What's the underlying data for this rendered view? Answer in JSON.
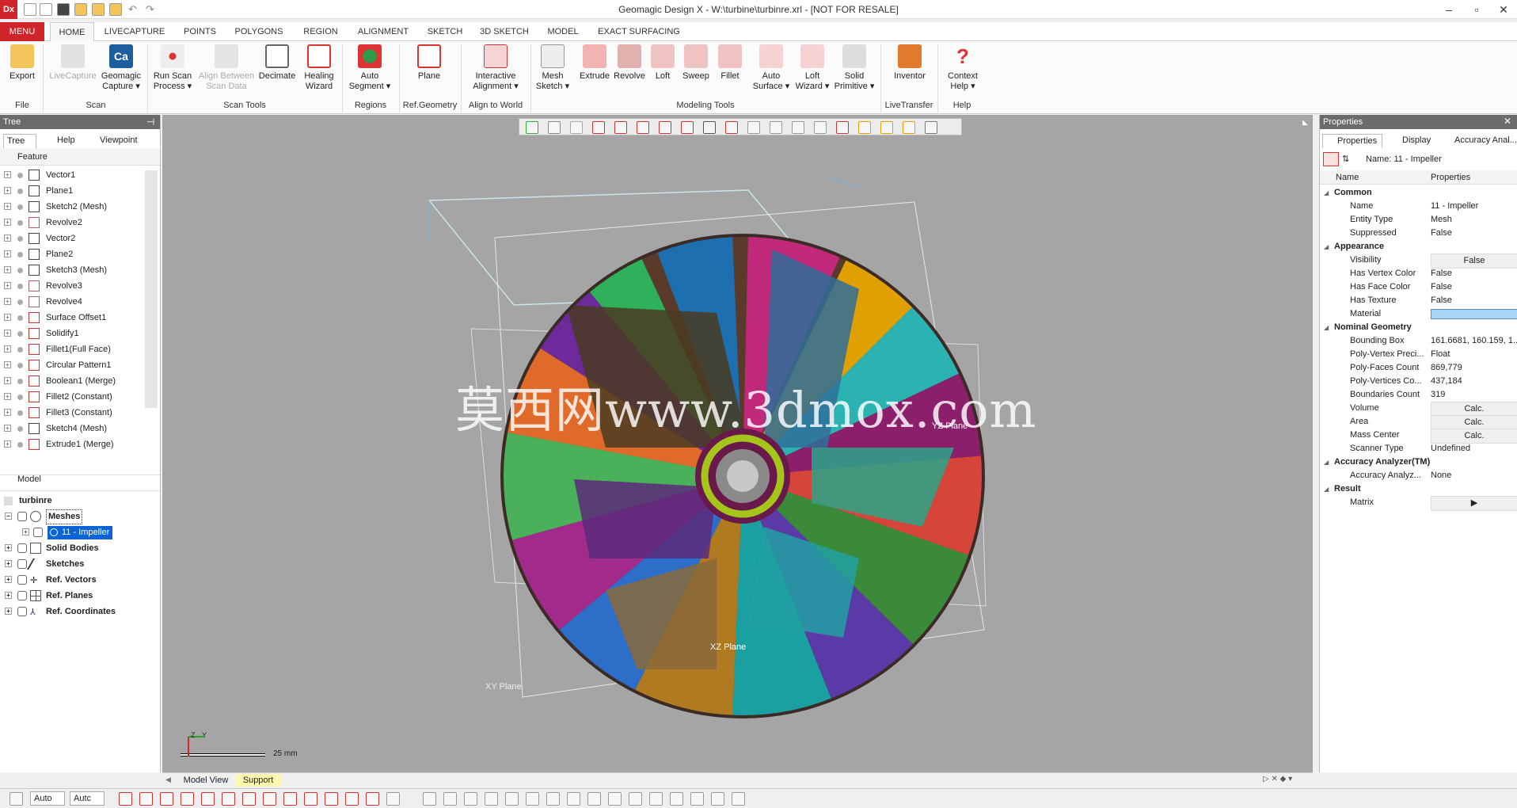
{
  "title": "Geomagic Design X - W:\\turbine\\turbinre.xrl - [NOT FOR RESALE]",
  "app_logo": "Dx",
  "window_controls": [
    "–",
    "▫",
    "✕"
  ],
  "menu_tabs": [
    "MENU",
    "HOME",
    "LIVECAPTURE",
    "POINTS",
    "POLYGONS",
    "REGION",
    "ALIGNMENT",
    "SKETCH",
    "3D SKETCH",
    "MODEL",
    "EXACT SURFACING"
  ],
  "ribbon": {
    "buttons": [
      {
        "label": "Export",
        "sub": ""
      },
      {
        "label": "LiveCapture",
        "sub": ""
      },
      {
        "label": "Geomagic",
        "sub": "Capture ▾"
      },
      {
        "label": "Run Scan",
        "sub": "Process ▾"
      },
      {
        "label": "Align Between",
        "sub": "Scan Data"
      },
      {
        "label": "Decimate",
        "sub": ""
      },
      {
        "label": "Healing",
        "sub": "Wizard"
      },
      {
        "label": "Auto",
        "sub": "Segment ▾"
      },
      {
        "label": "Plane",
        "sub": ""
      },
      {
        "label": "Interactive",
        "sub": "Alignment ▾"
      },
      {
        "label": "Mesh",
        "sub": "Sketch ▾"
      },
      {
        "label": "Extrude",
        "sub": ""
      },
      {
        "label": "Revolve",
        "sub": ""
      },
      {
        "label": "Loft",
        "sub": ""
      },
      {
        "label": "Sweep",
        "sub": ""
      },
      {
        "label": "Fillet",
        "sub": ""
      },
      {
        "label": "Auto",
        "sub": "Surface ▾"
      },
      {
        "label": "Loft",
        "sub": "Wizard ▾"
      },
      {
        "label": "Solid",
        "sub": "Primitive ▾"
      },
      {
        "label": "Inventor",
        "sub": ""
      },
      {
        "label": "Context",
        "sub": "Help ▾"
      }
    ],
    "groups": [
      "File",
      "Scan",
      "Scan Tools",
      "Regions",
      "Ref.Geometry",
      "Align to World",
      "Modeling Tools",
      "LiveTransfer",
      "Help"
    ]
  },
  "tree": {
    "panel_title": "Tree",
    "tabs": [
      "Tree",
      "Help",
      "Viewpoint"
    ],
    "feature_header": "Feature",
    "features": [
      "Vector1",
      "Plane1",
      "Sketch2 (Mesh)",
      "Revolve2",
      "Vector2",
      "Plane2",
      "Sketch3 (Mesh)",
      "Revolve3",
      "Revolve4",
      "Surface Offset1",
      "Solidify1",
      "Fillet1(Full Face)",
      "Circular Pattern1",
      "Boolean1 (Merge)",
      "Fillet2 (Constant)",
      "Fillet3 (Constant)",
      "Sketch4 (Mesh)",
      "Extrude1 (Merge)"
    ],
    "model_header": "Model",
    "model_root": "turbinre",
    "model_items": [
      "Meshes",
      "11 - Impeller",
      "Solid Bodies",
      "Sketches",
      "Ref. Vectors",
      "Ref. Planes",
      "Ref. Coordinates"
    ]
  },
  "viewport": {
    "watermark": "莫西网www.3dmox.com",
    "plane_labels": [
      "YZ Plane",
      "XZ Plane",
      "XY Plane"
    ],
    "scale_text": "25 mm",
    "axis_z": "Z",
    "axis_y": "Y"
  },
  "properties": {
    "panel_title": "Properties",
    "tabs": [
      "Properties",
      "Display",
      "Accuracy Anal..."
    ],
    "name_line": "Name: 11 - Impeller",
    "col_name": "Name",
    "col_props": "Properties",
    "rows": [
      {
        "k": "Common",
        "v": "",
        "cat": true
      },
      {
        "k": "Name",
        "v": "11 - Impeller"
      },
      {
        "k": "Entity Type",
        "v": "Mesh"
      },
      {
        "k": "Suppressed",
        "v": "False"
      },
      {
        "k": "Appearance",
        "v": "",
        "cat": true
      },
      {
        "k": "Visibility",
        "v": "False",
        "calc": true
      },
      {
        "k": "Has Vertex Color",
        "v": "False"
      },
      {
        "k": "Has Face Color",
        "v": "False"
      },
      {
        "k": "Has Texture",
        "v": "False"
      },
      {
        "k": "Material",
        "v": "",
        "swatch": true
      },
      {
        "k": "Nominal Geometry",
        "v": "",
        "cat": true
      },
      {
        "k": "Bounding Box",
        "v": "161.6681, 160.159, 1..."
      },
      {
        "k": "Poly-Vertex Preci...",
        "v": "Float"
      },
      {
        "k": "Poly-Faces Count",
        "v": "869,779"
      },
      {
        "k": "Poly-Vertices Co...",
        "v": "437,184"
      },
      {
        "k": "Boundaries Count",
        "v": "319"
      },
      {
        "k": "Volume",
        "v": "Calc.",
        "calc": true
      },
      {
        "k": "Area",
        "v": "Calc.",
        "calc": true
      },
      {
        "k": "Mass Center",
        "v": "Calc.",
        "calc": true
      },
      {
        "k": "Scanner Type",
        "v": "Undefined"
      },
      {
        "k": "Accuracy Analyzer(TM)",
        "v": "",
        "cat": true
      },
      {
        "k": "Accuracy Analyz...",
        "v": "None"
      },
      {
        "k": "Result",
        "v": "",
        "cat": true
      },
      {
        "k": "Matrix",
        "v": "▶",
        "calc": true
      }
    ]
  },
  "bottom_tabs": [
    "Model View",
    "Support"
  ],
  "status": {
    "sel1": "Auto",
    "sel2": "Autc"
  },
  "colors": {
    "accent": "#d0232a",
    "selection": "#0a64d8",
    "material": "#a8d4f5"
  }
}
